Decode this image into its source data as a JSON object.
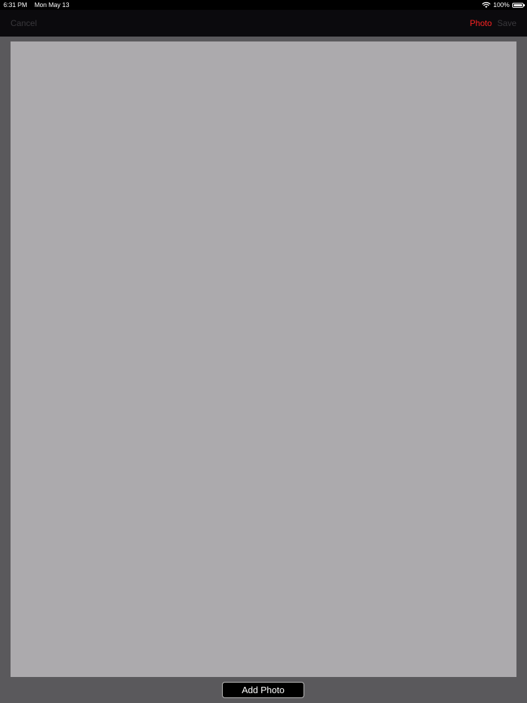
{
  "status_bar": {
    "time": "6:31 PM",
    "date": "Mon May 13",
    "battery_percent": "100%",
    "battery_level": 1.0,
    "icons": [
      "wifi-icon",
      "battery-icon"
    ]
  },
  "nav_bar": {
    "cancel_label": "Cancel",
    "photo_label": "Photo",
    "save_label": "Save"
  },
  "footer": {
    "add_photo_label": "Add Photo"
  },
  "colors": {
    "accent": "#ff2222",
    "disabled": "#3a393d",
    "background": "#5a595c",
    "canvas": "#acaaad",
    "bar": "#0b0a0d"
  }
}
